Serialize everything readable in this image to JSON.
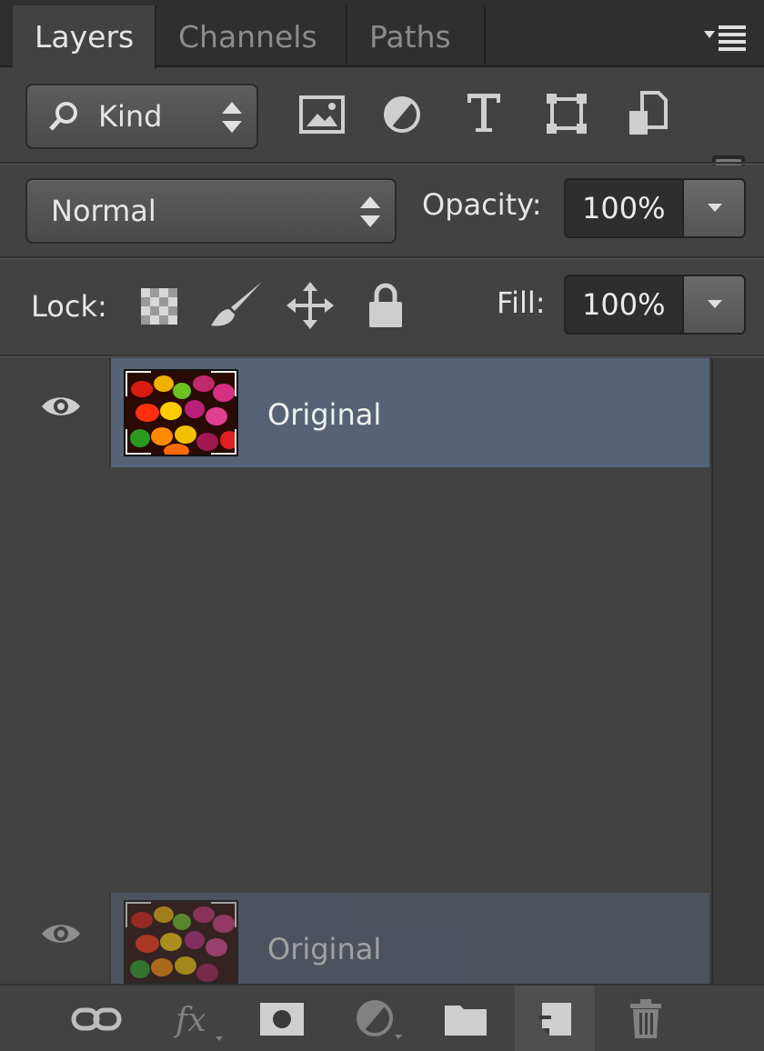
{
  "tabs": [
    {
      "label": "Layers",
      "active": true
    },
    {
      "label": "Channels",
      "active": false
    },
    {
      "label": "Paths",
      "active": false
    }
  ],
  "filter": {
    "kind_label": "Kind",
    "icons": [
      "image-filter-icon",
      "adjustment-filter-icon",
      "type-filter-icon",
      "shape-filter-icon",
      "smart-object-filter-icon"
    ]
  },
  "blend": {
    "mode": "Normal",
    "opacity_label": "Opacity:",
    "opacity_value": "100%"
  },
  "lock": {
    "label": "Lock:",
    "fill_label": "Fill:",
    "fill_value": "100%"
  },
  "layers": [
    {
      "name": "Original",
      "visible": true,
      "selected": true
    }
  ],
  "drag_ghost": {
    "name": "Original"
  },
  "bottom_toolbar": [
    "link-layers-icon",
    "fx-icon",
    "add-mask-icon",
    "adjustment-layer-icon",
    "new-group-icon",
    "new-layer-icon",
    "trash-icon"
  ],
  "colors": {
    "selected_layer": "#566275",
    "panel_bg": "#424242"
  }
}
